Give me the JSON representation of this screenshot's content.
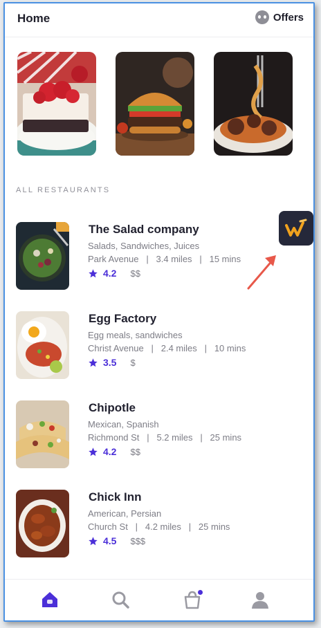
{
  "header": {
    "title": "Home",
    "offers_label": "Offers"
  },
  "banners": [
    {
      "name": "cake-dessert-banner"
    },
    {
      "name": "burger-banner"
    },
    {
      "name": "spaghetti-banner"
    }
  ],
  "section_label": "ALL RESTAURANTS",
  "restaurants": [
    {
      "name": "The Salad company",
      "cuisine": "Salads, Sandwiches, Juices",
      "meta": "Park Avenue   |   3.4 miles   |   15 mins",
      "rating": "4.2",
      "price": "$$"
    },
    {
      "name": "Egg Factory",
      "cuisine": "Egg meals, sandwiches",
      "meta": "Christ Avenue   |   2.4 miles   |   10 mins",
      "rating": "3.5",
      "price": "$"
    },
    {
      "name": "Chipotle",
      "cuisine": "Mexican, Spanish",
      "meta": "Richmond St   |   5.2 miles   |   25 mins",
      "rating": "4.2",
      "price": "$$"
    },
    {
      "name": "Chick Inn",
      "cuisine": "American, Persian",
      "meta": "Church St   |   4.2 miles   |   25 mins",
      "rating": "4.5",
      "price": "$$$"
    }
  ],
  "tabbar": {
    "tabs": [
      "home-icon",
      "search-icon",
      "cart-icon",
      "profile-icon"
    ],
    "active": "home-icon"
  },
  "colors": {
    "accent": "#4b2fd8",
    "badge_bg": "#25283a",
    "arrow": "#e8584a",
    "text_secondary": "#7d7d86"
  }
}
